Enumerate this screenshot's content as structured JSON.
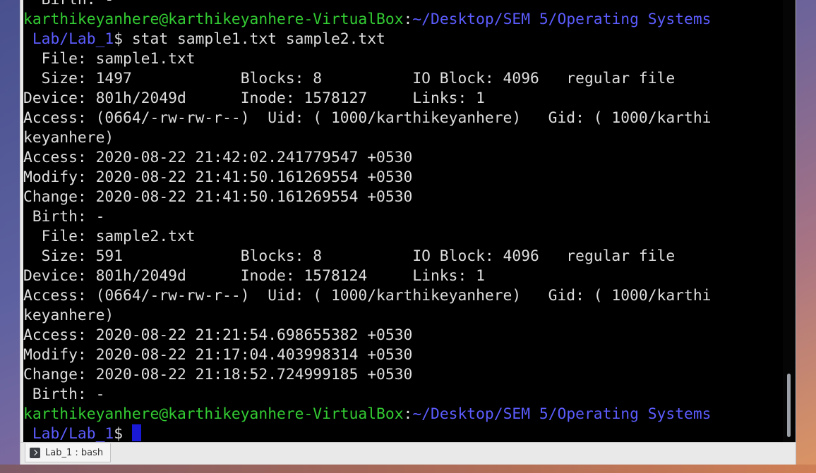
{
  "terminal": {
    "lines": [
      {
        "segments": [
          {
            "t": "  Birth: -",
            "c": "pw"
          }
        ]
      },
      {
        "segments": [
          {
            "t": "karthikeyanhere@karthikeyanhere-VirtualBox",
            "c": "pg"
          },
          {
            "t": ":",
            "c": "pw"
          },
          {
            "t": "~/Desktop/SEM 5/Operating Systems",
            "c": "pb"
          }
        ]
      },
      {
        "segments": [
          {
            "t": " Lab/Lab_1",
            "c": "pb"
          },
          {
            "t": "$ stat sample1.txt sample2.txt",
            "c": "pw"
          }
        ]
      },
      {
        "segments": [
          {
            "t": "  File: sample1.txt",
            "c": "pw"
          }
        ]
      },
      {
        "segments": [
          {
            "t": "  Size: 1497            Blocks: 8          IO Block: 4096   regular file",
            "c": "pw"
          }
        ]
      },
      {
        "segments": [
          {
            "t": "Device: 801h/2049d      Inode: 1578127     Links: 1",
            "c": "pw"
          }
        ]
      },
      {
        "segments": [
          {
            "t": "Access: (0664/-rw-rw-r--)  Uid: ( 1000/karthikeyanhere)   Gid: ( 1000/karthi",
            "c": "pw"
          }
        ]
      },
      {
        "segments": [
          {
            "t": "keyanhere)",
            "c": "pw"
          }
        ]
      },
      {
        "segments": [
          {
            "t": "Access: 2020-08-22 21:42:02.241779547 +0530",
            "c": "pw"
          }
        ]
      },
      {
        "segments": [
          {
            "t": "Modify: 2020-08-22 21:41:50.161269554 +0530",
            "c": "pw"
          }
        ]
      },
      {
        "segments": [
          {
            "t": "Change: 2020-08-22 21:41:50.161269554 +0530",
            "c": "pw"
          }
        ]
      },
      {
        "segments": [
          {
            "t": " Birth: -",
            "c": "pw"
          }
        ]
      },
      {
        "segments": [
          {
            "t": "  File: sample2.txt",
            "c": "pw"
          }
        ]
      },
      {
        "segments": [
          {
            "t": "  Size: 591             Blocks: 8          IO Block: 4096   regular file",
            "c": "pw"
          }
        ]
      },
      {
        "segments": [
          {
            "t": "Device: 801h/2049d      Inode: 1578124     Links: 1",
            "c": "pw"
          }
        ]
      },
      {
        "segments": [
          {
            "t": "Access: (0664/-rw-rw-r--)  Uid: ( 1000/karthikeyanhere)   Gid: ( 1000/karthi",
            "c": "pw"
          }
        ]
      },
      {
        "segments": [
          {
            "t": "keyanhere)",
            "c": "pw"
          }
        ]
      },
      {
        "segments": [
          {
            "t": "Access: 2020-08-22 21:21:54.698655382 +0530",
            "c": "pw"
          }
        ]
      },
      {
        "segments": [
          {
            "t": "Modify: 2020-08-22 21:17:04.403998314 +0530",
            "c": "pw"
          }
        ]
      },
      {
        "segments": [
          {
            "t": "Change: 2020-08-22 21:18:52.724999185 +0530",
            "c": "pw"
          }
        ]
      },
      {
        "segments": [
          {
            "t": " Birth: -",
            "c": "pw"
          }
        ]
      },
      {
        "segments": [
          {
            "t": "karthikeyanhere@karthikeyanhere-VirtualBox",
            "c": "pg"
          },
          {
            "t": ":",
            "c": "pw"
          },
          {
            "t": "~/Desktop/SEM 5/Operating Systems",
            "c": "pb"
          }
        ]
      },
      {
        "segments": [
          {
            "t": " Lab/Lab_1",
            "c": "pb"
          },
          {
            "t": "$ ",
            "c": "pw"
          }
        ],
        "cursor": true
      }
    ]
  },
  "tab": {
    "label": "Lab_1 : bash",
    "icon": "terminal-icon"
  },
  "colors": {
    "prompt_user": "#33cc33",
    "prompt_path": "#5c5cff",
    "text": "#dedede",
    "cursor": "#1a1ad6",
    "background": "#000000"
  }
}
